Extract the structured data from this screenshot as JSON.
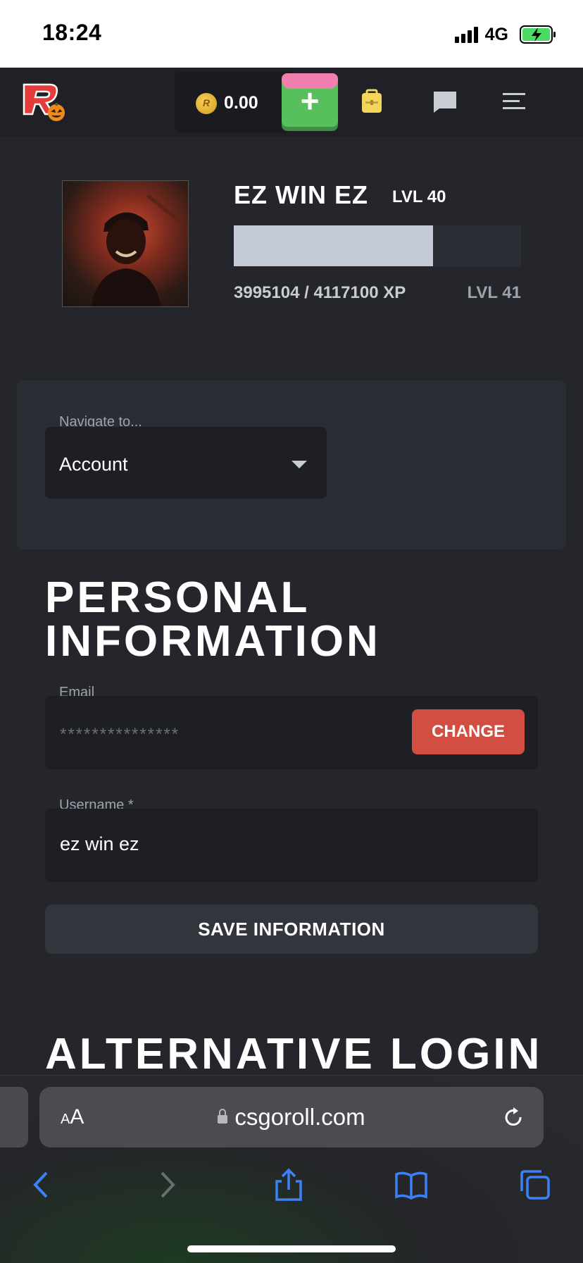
{
  "status_bar": {
    "time": "18:24",
    "network": "4G"
  },
  "header": {
    "balance": "0.00",
    "coin_letter": "R",
    "icons": [
      "logo-icon",
      "coin-icon",
      "plus-icon",
      "backpack-icon",
      "chat-icon",
      "menu-icon"
    ]
  },
  "profile": {
    "name": "EZ WIN EZ",
    "level": "LVL 40",
    "xp_text": "3995104 / 4117100 XP",
    "next_level": "LVL 41",
    "xp_progress": 0.6926
  },
  "navigate": {
    "label": "Navigate to...",
    "value": "Account"
  },
  "personal": {
    "title_line1": "PERSONAL",
    "title_line2": "INFORMATION",
    "email_label": "Email",
    "email_value": "***************",
    "change_label": "CHANGE",
    "username_label": "Username *",
    "username_value": "ez win ez",
    "save_label": "SAVE INFORMATION"
  },
  "alternative": {
    "title": "ALTERNATIVE LOGIN"
  },
  "browser": {
    "aa_small": "A",
    "aa_big": "A",
    "url": "csgoroll.com"
  },
  "colors": {
    "accent_green": "#57c05c",
    "change_red": "#d24e43",
    "background": "#24262c"
  }
}
